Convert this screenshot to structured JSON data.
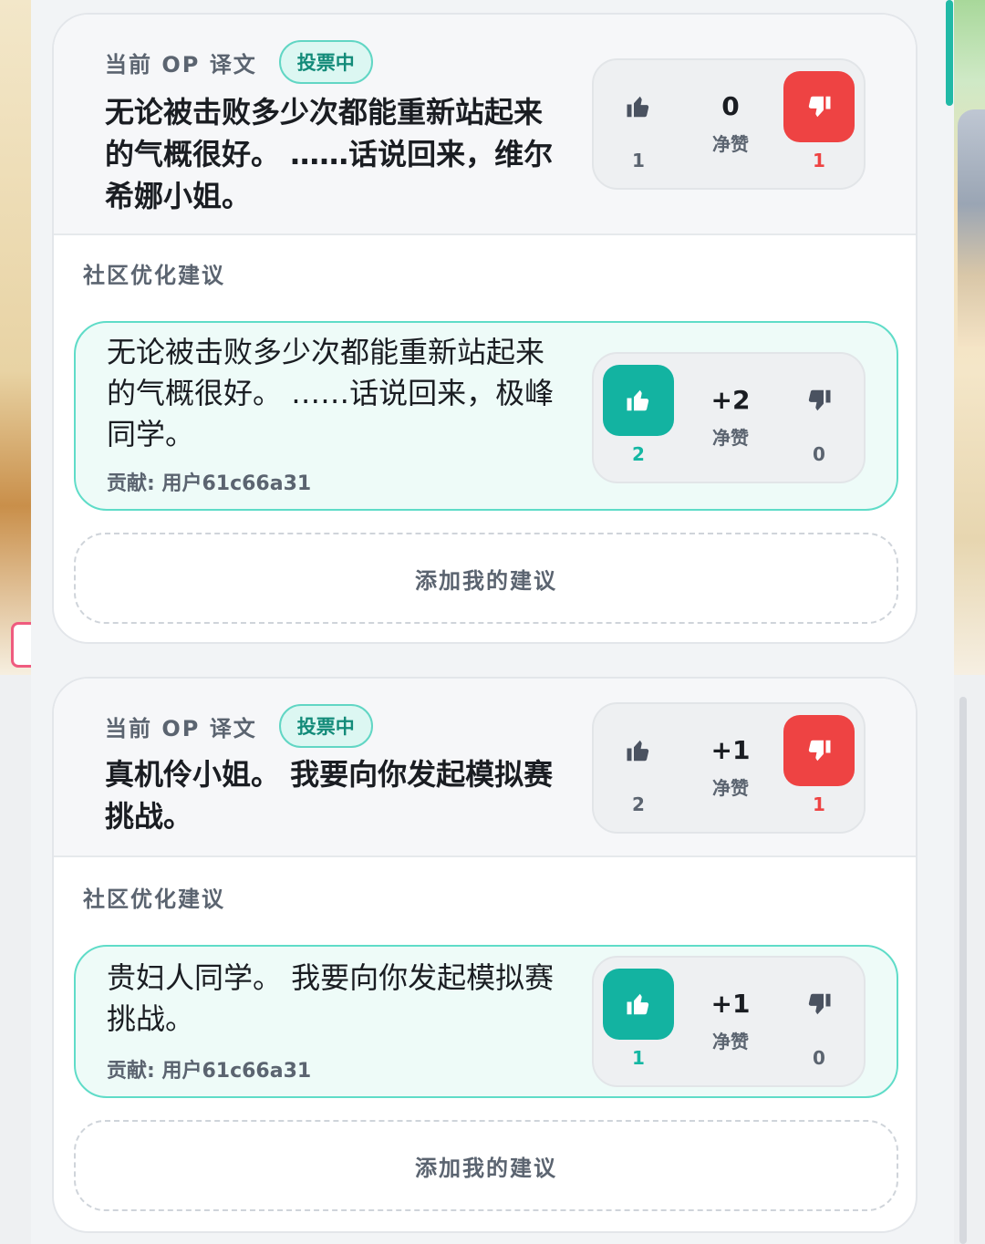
{
  "colors": {
    "accent_teal": "#13b3a1",
    "downvote_red": "#ee4343",
    "badge_bg": "#dcf7f2",
    "suggestion_bg": "#eefbf8"
  },
  "icons": {
    "upvote": "thumbs-up-icon",
    "downvote": "thumbs-down-icon"
  },
  "entries": [
    {
      "op_label": "当前 OP 译文",
      "badge": "投票中",
      "op_text": "无论被击败多少次都能重新站起来的气概很好。 ……话说回来，维尔希娜小姐。",
      "op_votes": {
        "net": "0",
        "net_label": "净赞",
        "up": "1",
        "down": "1"
      },
      "section_label": "社区优化建议",
      "suggestion": {
        "text": "无论被击败多少次都能重新站起来的气概很好。 ……话说回来，极峰同学。",
        "contributor": "贡献: 用户61c66a31",
        "votes": {
          "net": "+2",
          "net_label": "净赞",
          "up": "2",
          "down": "0"
        }
      },
      "add_label": "添加我的建议"
    },
    {
      "op_label": "当前 OP 译文",
      "badge": "投票中",
      "op_text": "真机伶小姐。 我要向你发起模拟赛挑战。",
      "op_votes": {
        "net": "+1",
        "net_label": "净赞",
        "up": "2",
        "down": "1"
      },
      "section_label": "社区优化建议",
      "suggestion": {
        "text": "贵妇人同学。 我要向你发起模拟赛挑战。",
        "contributor": "贡献: 用户61c66a31",
        "votes": {
          "net": "+1",
          "net_label": "净赞",
          "up": "1",
          "down": "0"
        }
      },
      "add_label": "添加我的建议"
    }
  ]
}
